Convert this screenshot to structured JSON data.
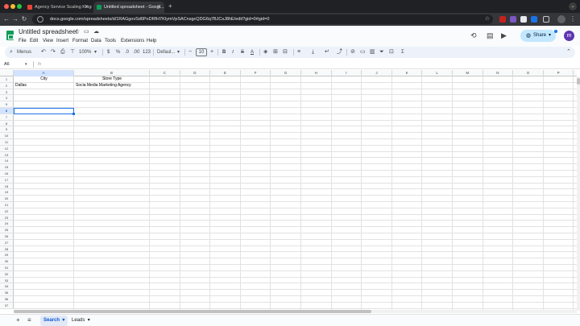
{
  "browser": {
    "tabs": [
      {
        "title": "Agency Service Scaling Kingd...",
        "favicon_color": "#ea4335",
        "active": false
      },
      {
        "title": "Untitled spreadsheet - Googl...",
        "favicon_color": "#0f9d58",
        "active": true
      }
    ],
    "new_tab": "+",
    "url": "docs.google.com/spreadsheets/d/1RAGgovSd6PoDRfH7KIymVpSACnsgcQDG6q7BJCsJ8hE/edit?gid=0#gid=0"
  },
  "doc": {
    "title": "Untitled spreadsheet",
    "menus": [
      "File",
      "Edit",
      "View",
      "Insert",
      "Format",
      "Data",
      "Tools",
      "Extensions",
      "Help"
    ],
    "share_label": "Share",
    "avatar_initial": "m"
  },
  "toolbar": {
    "search_label": "Menus",
    "zoom": "100%",
    "currency": "$",
    "percent": "%",
    "dec_decrease": ".0",
    "dec_increase": ".00",
    "number_format": "123",
    "font": "Defaul...",
    "font_size": "10",
    "bold": "B",
    "italic": "I",
    "text_color": "A",
    "functions": "Σ"
  },
  "formula_bar": {
    "name_box": "A6",
    "fx": "fx",
    "value": ""
  },
  "grid": {
    "columns": [
      "A",
      "B",
      "C",
      "D",
      "E",
      "F",
      "G",
      "H",
      "I",
      "J",
      "K",
      "L",
      "M",
      "N",
      "O",
      "P"
    ],
    "rows": [
      "1",
      "2",
      "3",
      "4",
      "5",
      "6",
      "7",
      "8",
      "9",
      "10",
      "11",
      "12",
      "13",
      "14",
      "15",
      "16",
      "17",
      "18",
      "19",
      "20",
      "21",
      "22",
      "23",
      "24",
      "25",
      "26",
      "27",
      "28",
      "29",
      "30",
      "31",
      "32",
      "33",
      "34",
      "35",
      "36",
      "37"
    ],
    "selected_cell": "A6",
    "cells": {
      "A1": "City",
      "B1": "Store Type",
      "A2": "Dallas",
      "B2": "Socia Media Marketing Agency"
    }
  },
  "sheets": {
    "add": "+",
    "all_sheets": "≡",
    "tabs": [
      {
        "name": "Search",
        "active": true
      },
      {
        "name": "Leads",
        "active": false
      }
    ]
  },
  "colors": {
    "accent": "#1a73e8",
    "sheets_green": "#0f9d58",
    "share_bg": "#c2e7ff"
  }
}
